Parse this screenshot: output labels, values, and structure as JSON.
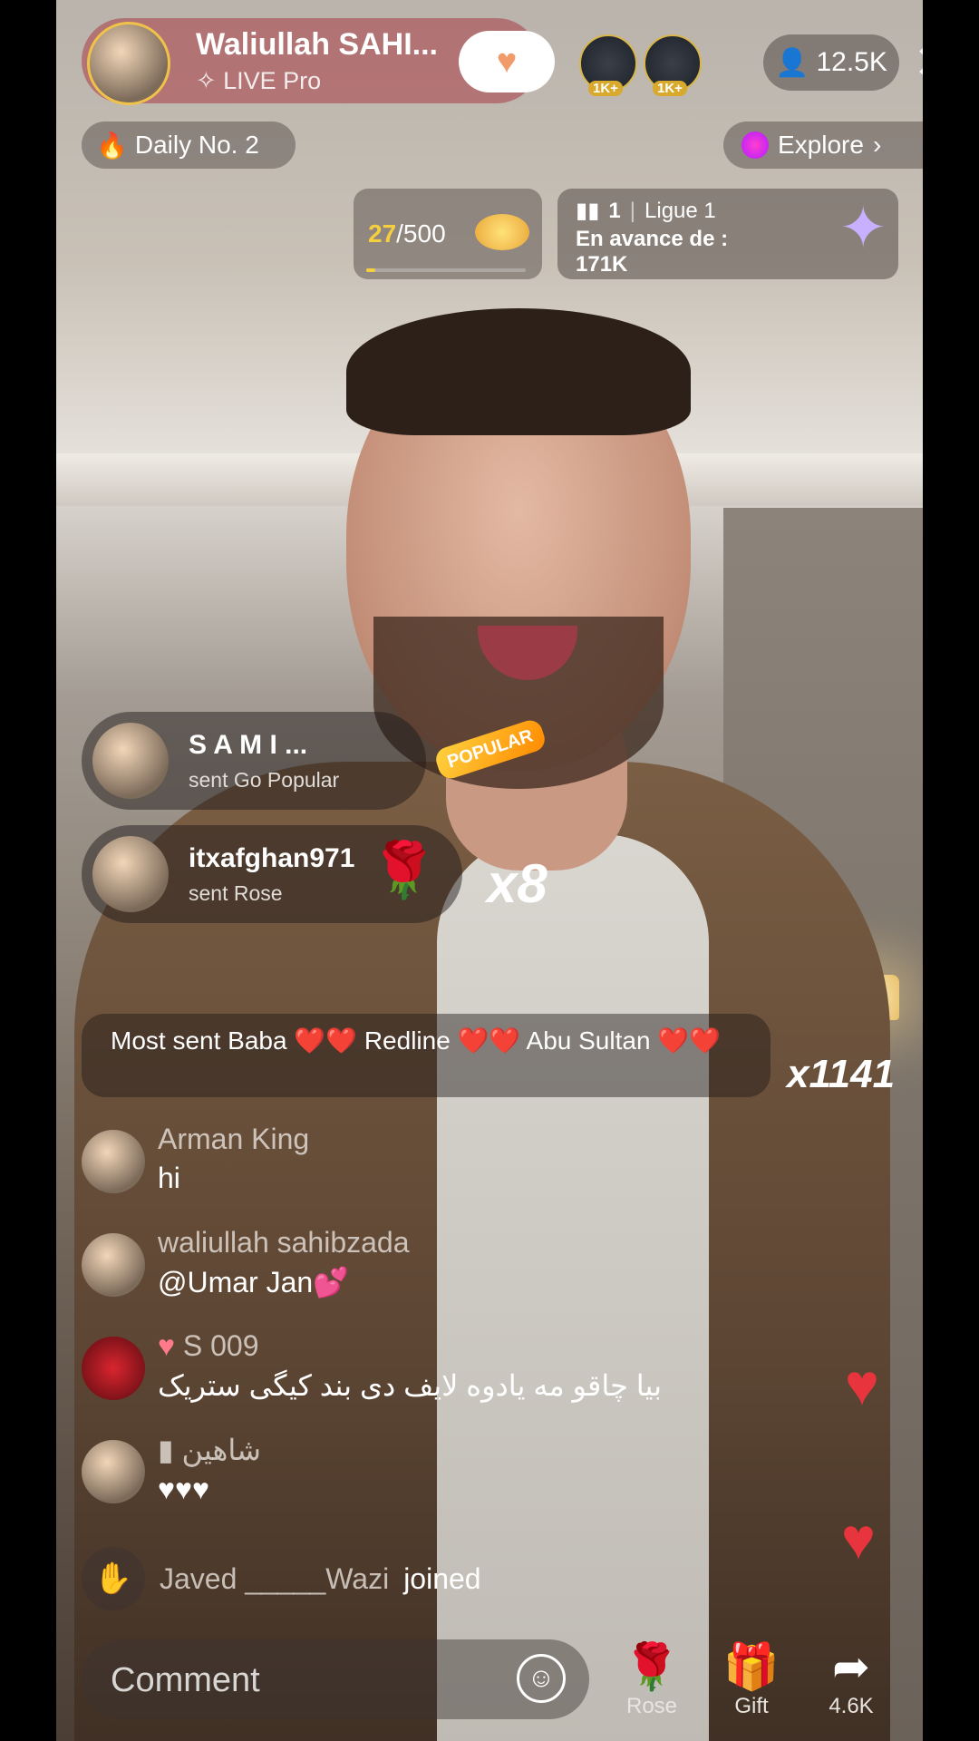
{
  "host": {
    "name": "Waliullah SAHI...",
    "badge": "✧ LIVE Pro"
  },
  "top_viewers": [
    {
      "tag": "1K+"
    },
    {
      "tag": "1K+"
    }
  ],
  "viewer_count": "12.5K",
  "daily": "Daily No. 2",
  "explore": "Explore",
  "goal": {
    "current": "27",
    "total": "/500",
    "progress": 0.054
  },
  "league": {
    "rank": "1",
    "name": "Ligue 1",
    "lead_text": "En avance de : 171K"
  },
  "gifts": [
    {
      "user": "S A M I ...",
      "action": "sent Go Popular",
      "gift_tag": "POPULAR"
    },
    {
      "user": "itxafghan971",
      "action": "sent Rose",
      "count": "x8"
    }
  ],
  "most_sent": "Most sent Baba ❤️❤️ Redline ❤️❤️ Abu Sultan ❤️❤️",
  "combo": "x1141",
  "chat": [
    {
      "name": "Arman King",
      "message": "hi"
    },
    {
      "name": "waliullah sahibzada",
      "message": "@Umar Jan💕"
    },
    {
      "name": "S 009",
      "message": "بیا چاقو مه یادوه لایف دی بند کیگی ستریک"
    },
    {
      "name": "شاهین",
      "message": "♥♥♥"
    }
  ],
  "joined": {
    "user": "Javed _____Wazi",
    "action": "joined"
  },
  "comment_placeholder": "Comment",
  "actions": [
    {
      "label": "Rose",
      "icon": "rose-icon"
    },
    {
      "label": "Gift",
      "icon": "gift-icon"
    },
    {
      "label": "4.6K",
      "icon": "share-icon"
    }
  ]
}
